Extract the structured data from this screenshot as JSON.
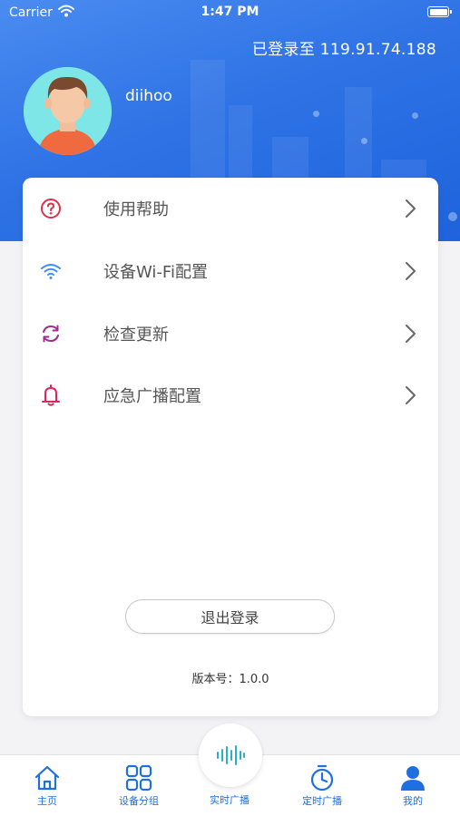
{
  "status_bar": {
    "carrier": "Carrier",
    "time": "1:47 PM"
  },
  "header": {
    "login_info": "已登录至 119.91.74.188",
    "username": "diihoo"
  },
  "menu": [
    {
      "label": "使用帮助",
      "icon": "help-circle-icon",
      "color": "#d9334a"
    },
    {
      "label": "设备Wi-Fi配置",
      "icon": "wifi-icon",
      "color": "#3b8ff2"
    },
    {
      "label": "检查更新",
      "icon": "refresh-icon",
      "color": "#a0308f"
    },
    {
      "label": "应急广播配置",
      "icon": "alarm-bell-icon",
      "color": "#e0245e"
    }
  ],
  "logout_label": "退出登录",
  "version": "版本号：1.0.0",
  "tabs": [
    {
      "label": "主页",
      "icon": "home-icon"
    },
    {
      "label": "设备分组",
      "icon": "grid-icon"
    },
    {
      "label": "实时广播",
      "icon": "audio-wave-icon"
    },
    {
      "label": "定时广播",
      "icon": "timer-icon"
    },
    {
      "label": "我的",
      "icon": "user-icon"
    }
  ],
  "colors": {
    "accent": "#1f6fe0",
    "header_blue": "#2f73e6",
    "avatar_bg": "#7fe6e8"
  }
}
